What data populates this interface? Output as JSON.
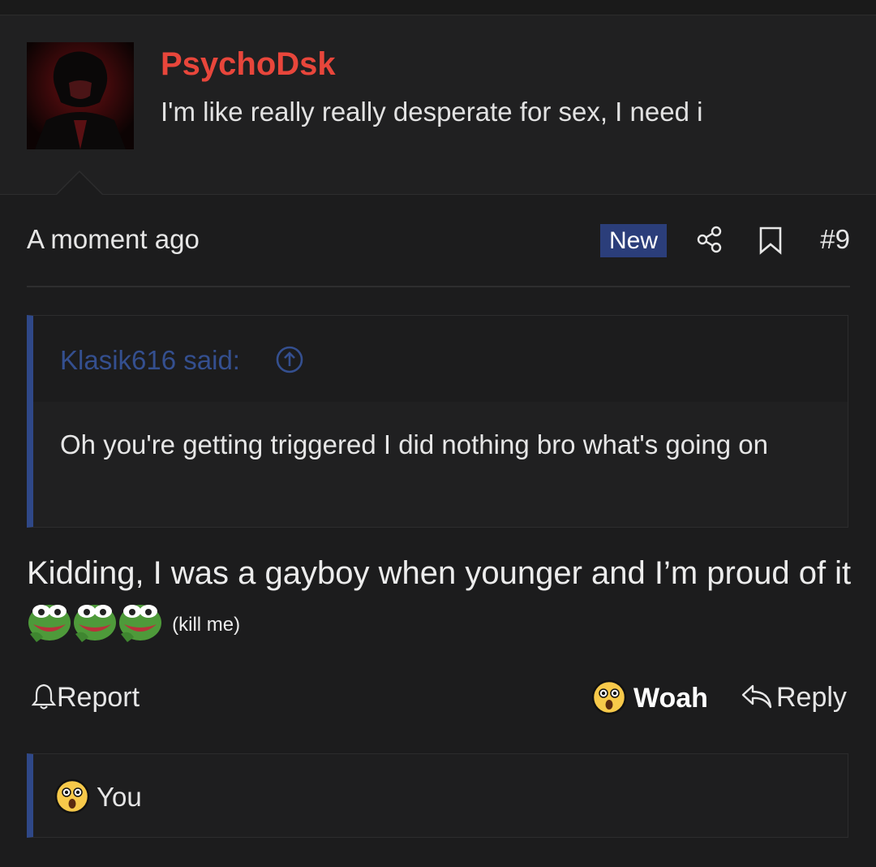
{
  "post": {
    "username": "PsychoDsk",
    "user_title": "I'm like really really desperate for sex, I need i",
    "time": "A moment ago",
    "badge": "New",
    "number": "#9"
  },
  "quote": {
    "author_label": "Klasik616 said:",
    "text": "Oh you're getting triggered I did nothing bro what's going on"
  },
  "message": {
    "text": "Kidding, I was a gayboy when younger and I’m proud of it",
    "emoji_count": 3,
    "emoji_name": "pepe-laugh",
    "small_text": "(kill me)"
  },
  "actions": {
    "report": "Report",
    "reaction": "Woah",
    "reply": "Reply"
  },
  "reactions_bar": {
    "label": "You"
  },
  "colors": {
    "username": "#e8463b",
    "accent": "#2f4888",
    "badge_bg": "#2b3e7a"
  }
}
